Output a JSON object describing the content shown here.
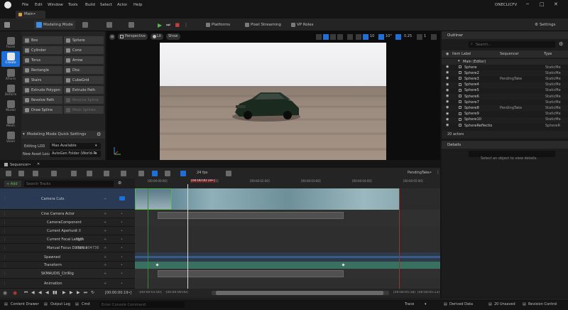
{
  "menubar": {
    "items": [
      "File",
      "Edit",
      "Window",
      "Tools",
      "Build",
      "Select",
      "Actor",
      "Help"
    ],
    "project": "ONECLICFV"
  },
  "tabs": {
    "main": "Main•"
  },
  "toolbar": {
    "mode": "Modeling Mode",
    "platforms": "Platforms",
    "pixel_streaming": "Pixel Streaming",
    "vp_roles": "VP Roles",
    "settings": "Settings"
  },
  "tools_bar": [
    {
      "label": "Faces"
    },
    {
      "label": "Create"
    },
    {
      "label": "XForm"
    },
    {
      "label": "Deform"
    },
    {
      "label": "Model"
    },
    {
      "label": "Mesh"
    },
    {
      "label": "Voxel"
    }
  ],
  "tool_panel": {
    "buttons": [
      [
        "Box",
        "Sphere"
      ],
      [
        "Cylinder",
        "Cone"
      ],
      [
        "Torus",
        "Arrow"
      ],
      [
        "Rectangle",
        "Disc"
      ],
      [
        "Stairs",
        "CubeGrid"
      ],
      [
        "Extrude Polygon",
        "Extrude Path"
      ],
      [
        "Revolve Path",
        "Revolve Spline"
      ],
      [
        "Draw Spline",
        "Mesh Splines"
      ]
    ],
    "quick_settings": "Modeling Mode Quick Settings",
    "editing_lod_label": "Editing LOD",
    "editing_lod_value": "Max Available",
    "new_asset_label": "New Asset Loca",
    "new_asset_value": "AutoGen Folder (World-R"
  },
  "viewport": {
    "perspective": "Perspective",
    "lit": "Lit",
    "show": "Show",
    "grid_size": "10",
    "rot_snap": "10°",
    "scale_snap": "0.25",
    "cam_speed": "1"
  },
  "outliner": {
    "title": "Outliner",
    "search_placeholder": "Search...",
    "col_label": "Item Label",
    "col_sequencer": "Sequencer",
    "col_type": "Type",
    "root": "Main (Editor)",
    "rows": [
      {
        "label": "Sphere",
        "seq": "",
        "type": "StaticMe"
      },
      {
        "label": "Sphere2",
        "seq": "",
        "type": "StaticMe"
      },
      {
        "label": "Sphere3",
        "seq": "PendingTake",
        "type": "StaticMe"
      },
      {
        "label": "Sphere4",
        "seq": "",
        "type": "StaticMe"
      },
      {
        "label": "Sphere5",
        "seq": "",
        "type": "StaticMe"
      },
      {
        "label": "Sphere6",
        "seq": "",
        "type": "StaticMe"
      },
      {
        "label": "Sphere7",
        "seq": "",
        "type": "StaticMe"
      },
      {
        "label": "Sphere8",
        "seq": "PendingTake",
        "type": "StaticMe"
      },
      {
        "label": "Sphere9",
        "seq": "",
        "type": "StaticMe"
      },
      {
        "label": "Sphere10",
        "seq": "",
        "type": "StaticMe"
      },
      {
        "label": "SphereReflectio",
        "seq": "",
        "type": "SphereR"
      }
    ],
    "count": "20 actors"
  },
  "details": {
    "title": "Details",
    "empty": "Select an object to view details."
  },
  "sequencer": {
    "tab": "Sequencer•",
    "fps": "24 fps",
    "take": "PendingTake•",
    "add": "+ Add",
    "search_placeholder": "Search Tracks",
    "time_marker": "[00:00:00:19•]",
    "ruler": [
      "[00:00:00:00]",
      "[00:00:01:00]",
      "[00:00:02:00]",
      "[00:00:03:00]",
      "[00:00:04:00]",
      "[00:00:05:00]"
    ],
    "tracks": [
      {
        "label": "Camera Cuts",
        "value": ""
      },
      {
        "label": "Cine Camera Actor",
        "value": ""
      },
      {
        "label": "CameraComponent",
        "value": ""
      },
      {
        "label": "Current Aperture",
        "value": "2.8"
      },
      {
        "label": "Current Focal Length",
        "value": "35.0"
      },
      {
        "label": "Manual Focus Distance",
        "value": "2389.104736"
      },
      {
        "label": "Spawned",
        "value": ""
      },
      {
        "label": "Transform",
        "value": ""
      },
      {
        "label": "SKMAUDIS_CtrlRig",
        "value": ""
      },
      {
        "label": "Animation",
        "value": ""
      }
    ],
    "bottom_time": "[00:00:00:19•]",
    "range_start_a": "-[00:00:01:00]",
    "range_start_b": "-[00:00:00:00]",
    "range_end_a": "[00:00:05:18]",
    "range_end_b": "[00:00:05:13]"
  },
  "statusbar": {
    "content_drawer": "Content Drawer",
    "output_log": "Output Log",
    "cmd": "Cmd",
    "console_placeholder": "Enter Console Command",
    "trace": "Trace",
    "derived": "Derived Data",
    "unsaved": "20 Unsaved",
    "revision": "Revision Control"
  }
}
